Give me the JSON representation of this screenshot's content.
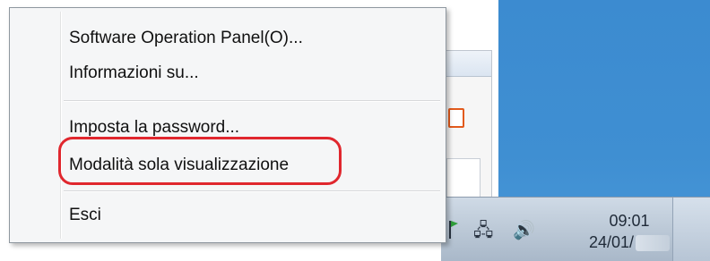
{
  "menu": {
    "items": [
      {
        "label": "Software Operation Panel(O)..."
      },
      {
        "label": "Informazioni su..."
      },
      {
        "label": "Imposta la password..."
      },
      {
        "label": "Modalità sola visualizzazione"
      },
      {
        "label": "Esci"
      }
    ],
    "highlighted_index": 3,
    "highlight_color": "#e0272e"
  },
  "taskbar": {
    "clock": {
      "time": "09:01",
      "date": "24/01/"
    },
    "tray_icons": [
      "action-center-flag-icon",
      "network-icon",
      "volume-icon"
    ]
  },
  "colors": {
    "desktop": "#3c8bd0",
    "menu_background": "#f5f6f7",
    "taskbar": "#bcc9d7"
  }
}
